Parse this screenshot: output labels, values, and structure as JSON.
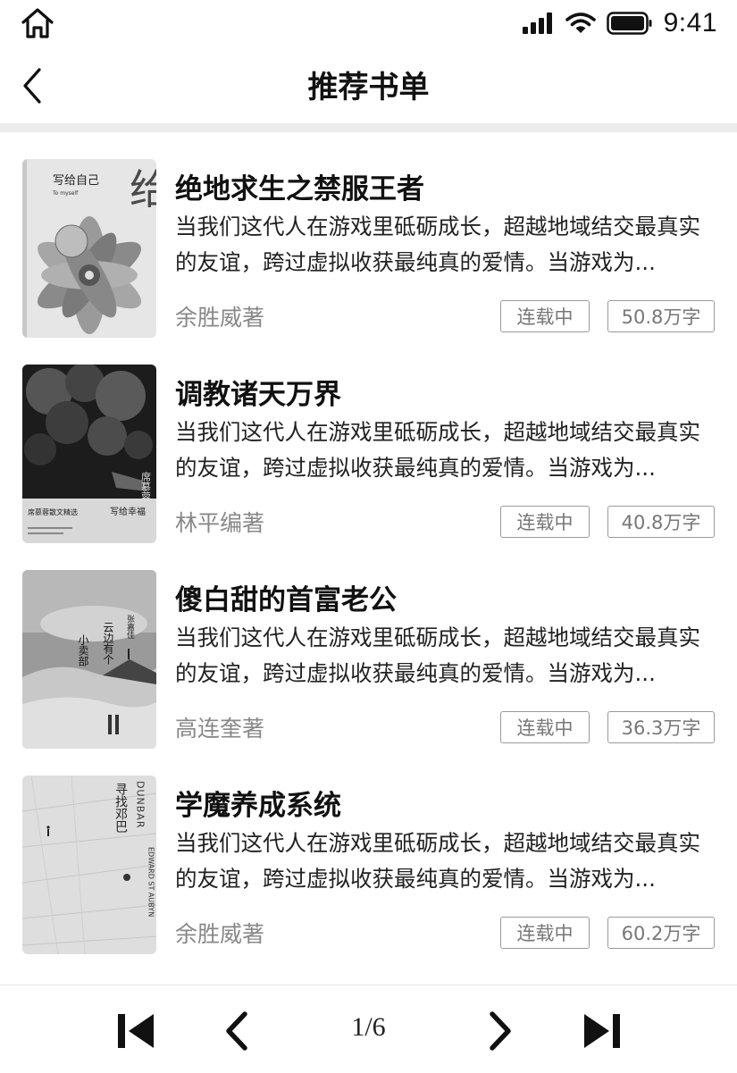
{
  "status_bar": {
    "time": "9:41"
  },
  "header": {
    "title": "推荐书单"
  },
  "books": [
    {
      "title": "绝地求生之禁服王者",
      "description": "当我们这代人在游戏里砥砺成长，超越地域结交最真实的友谊，跨过虚拟收获最纯真的爱情。当游戏为...",
      "author": "余胜威著",
      "status": "连载中",
      "word_count": "50.8万字",
      "cover_text": {
        "main": "写给自己",
        "sub": "To myself",
        "art": "给自"
      }
    },
    {
      "title": "调教诸天万界",
      "description": "当我们这代人在游戏里砥砺成长，超越地域结交最真实的友谊，跨过虚拟收获最纯真的爱情。当游戏为...",
      "author": "林平编著",
      "status": "连载中",
      "word_count": "40.8万字",
      "cover_text": {
        "author": "席慕蓉",
        "series": "席慕蓉散文精选",
        "main": "写给幸福"
      }
    },
    {
      "title": "傻白甜的首富老公",
      "description": "当我们这代人在游戏里砥砺成长，超越地域结交最真实的友谊，跨过虚拟收获最纯真的爱情。当游戏为...",
      "author": "高连奎著",
      "status": "连载中",
      "word_count": "36.3万字",
      "cover_text": {
        "main_a": "云边有个",
        "main_b": "小卖部",
        "author": "张嘉佳"
      }
    },
    {
      "title": "学魔养成系统",
      "description": "当我们这代人在游戏里砥砺成长，超越地域结交最真实的友谊，跨过虚拟收获最纯真的爱情。当游戏为...",
      "author": "余胜威著",
      "status": "连载中",
      "word_count": "60.2万字",
      "cover_text": {
        "main": "寻找邓巴",
        "en_title": "DUNBAR",
        "en_author": "EDWARD ST AUBYN"
      }
    }
  ],
  "pagination": {
    "current_page": "1/6"
  },
  "icons": {
    "home": "home-icon",
    "back": "chevron-left-icon",
    "first": "skip-first-icon",
    "prev": "chevron-left-icon",
    "next": "chevron-right-icon",
    "last": "skip-last-icon"
  },
  "colors": {
    "tag_border": "#9a9a9a",
    "secondary_text": "#888888",
    "divider": "#ececec"
  }
}
